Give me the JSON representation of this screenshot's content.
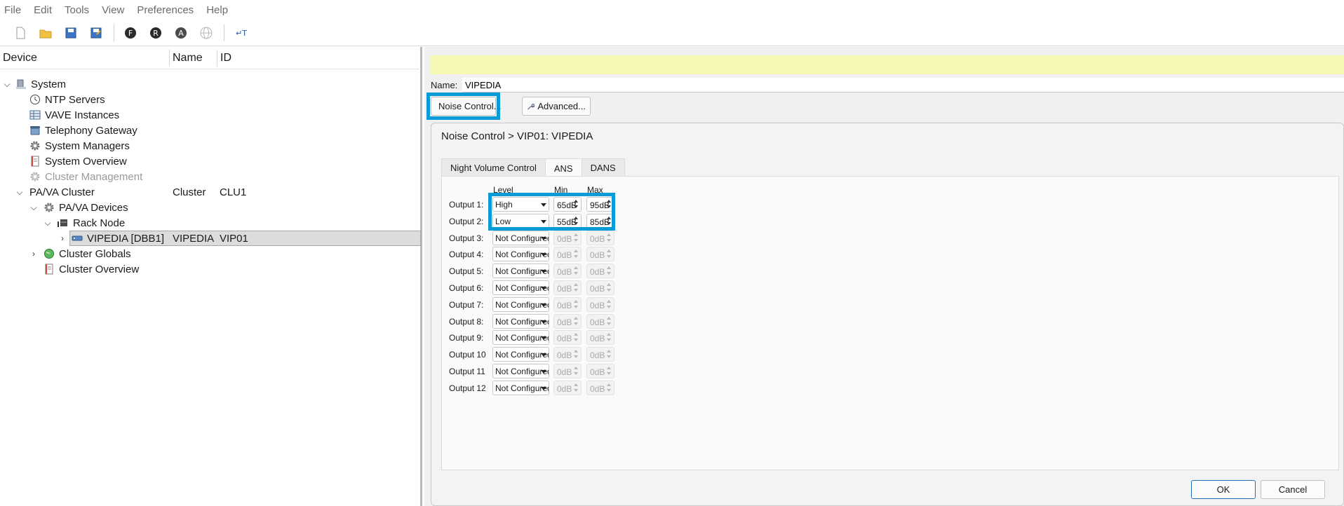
{
  "menu": [
    "File",
    "Edit",
    "Tools",
    "View",
    "Preferences",
    "Help"
  ],
  "toolbar": {
    "icons": [
      "new-file-icon",
      "open-folder-icon",
      "save-icon",
      "save-as-icon",
      "f-circle-icon",
      "r-circle-icon",
      "a-circle-icon",
      "globe-icon",
      "text-insert-icon"
    ]
  },
  "tree": {
    "headers": {
      "device": "Device",
      "name": "Name",
      "id": "ID"
    },
    "rows": [
      {
        "label": "System",
        "name": "",
        "id": ""
      },
      {
        "label": "NTP Servers",
        "name": "",
        "id": ""
      },
      {
        "label": "VAVE Instances",
        "name": "",
        "id": ""
      },
      {
        "label": "Telephony Gateway",
        "name": "",
        "id": ""
      },
      {
        "label": "System Managers",
        "name": "",
        "id": ""
      },
      {
        "label": "System Overview",
        "name": "",
        "id": ""
      },
      {
        "label": "Cluster Management",
        "name": "",
        "id": ""
      },
      {
        "label": "PA/VA Cluster",
        "name": "Cluster",
        "id": "CLU1"
      },
      {
        "label": "PA/VA Devices",
        "name": "",
        "id": ""
      },
      {
        "label": "Rack Node",
        "name": "",
        "id": ""
      },
      {
        "label": "VIPEDIA [DBB1]",
        "name": "VIPEDIA",
        "id": "VIP01"
      },
      {
        "label": "Cluster Globals",
        "name": "",
        "id": ""
      },
      {
        "label": "Cluster Overview",
        "name": "",
        "id": ""
      }
    ]
  },
  "details": {
    "name_label": "Name:",
    "name_value": "VIPEDIA",
    "noise_button": "Noise Control...",
    "advanced_button": "Advanced..."
  },
  "dialog": {
    "title": "Noise Control > VIP01: VIPEDIA",
    "tabs": [
      "Night Volume Control",
      "ANS",
      "DANS"
    ],
    "active_tab": "ANS",
    "col_level": "Level",
    "col_min": "Min",
    "col_max": "Max",
    "outputs": [
      {
        "label": "Output 1:",
        "level": "High",
        "min": "65dB",
        "max": "95dB",
        "enabled": true
      },
      {
        "label": "Output 2:",
        "level": "Low",
        "min": "55dB",
        "max": "85dB",
        "enabled": true
      },
      {
        "label": "Output 3:",
        "level": "Not Configured",
        "min": "0dB",
        "max": "0dB",
        "enabled": false
      },
      {
        "label": "Output 4:",
        "level": "Not Configured",
        "min": "0dB",
        "max": "0dB",
        "enabled": false
      },
      {
        "label": "Output 5:",
        "level": "Not Configured",
        "min": "0dB",
        "max": "0dB",
        "enabled": false
      },
      {
        "label": "Output 6:",
        "level": "Not Configured",
        "min": "0dB",
        "max": "0dB",
        "enabled": false
      },
      {
        "label": "Output 7:",
        "level": "Not Configured",
        "min": "0dB",
        "max": "0dB",
        "enabled": false
      },
      {
        "label": "Output 8:",
        "level": "Not Configured",
        "min": "0dB",
        "max": "0dB",
        "enabled": false
      },
      {
        "label": "Output 9:",
        "level": "Not Configured",
        "min": "0dB",
        "max": "0dB",
        "enabled": false
      },
      {
        "label": "Output 10",
        "level": "Not Configured",
        "min": "0dB",
        "max": "0dB",
        "enabled": false
      },
      {
        "label": "Output 11",
        "level": "Not Configured",
        "min": "0dB",
        "max": "0dB",
        "enabled": false
      },
      {
        "label": "Output 12",
        "level": "Not Configured",
        "min": "0dB",
        "max": "0dB",
        "enabled": false
      }
    ],
    "ok": "OK",
    "cancel": "Cancel"
  },
  "colors": {
    "highlight": "#0a9ad8",
    "info_bar": "#f6f8b4"
  }
}
